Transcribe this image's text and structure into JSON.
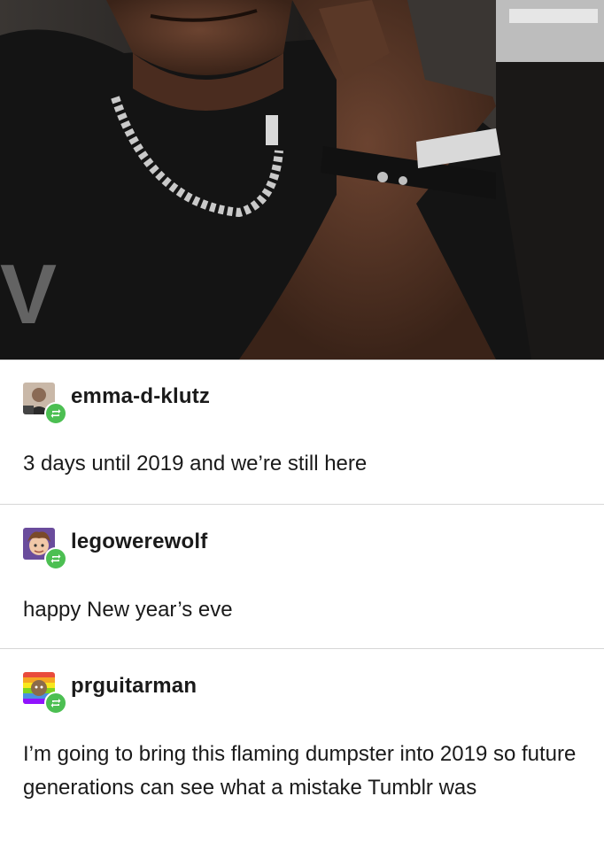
{
  "photo": {
    "watermark_letter": "V"
  },
  "posts": [
    {
      "username": "emma-d-klutz",
      "text": "3 days until 2019 and we’re still here"
    },
    {
      "username": "legowerewolf",
      "text": "happy New year’s eve"
    },
    {
      "username": "prguitarman",
      "text": "I’m going to bring this flaming dumpster into 2019 so future generations can see what a mistake Tumblr was"
    }
  ],
  "icons": {
    "reblog": "reblog-icon"
  },
  "colors": {
    "reblog_badge": "#4cbf52",
    "divider": "#d6d6d6",
    "text": "#1a1a1a"
  }
}
